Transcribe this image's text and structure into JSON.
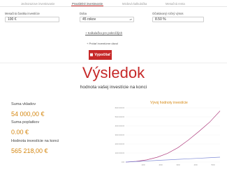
{
  "tabs": [
    {
      "label": "Jednorazove investovanie"
    },
    {
      "label": "Pravidelné investovanie"
    },
    {
      "label": "Mzdová kalkulačka"
    },
    {
      "label": "Mesačná renta"
    }
  ],
  "form": {
    "monthly_label": "Mesačná čiastka investície",
    "monthly_value": "100 €",
    "duration_label": "Doba",
    "duration_value": "45 rokov",
    "return_label": "Očakávaný ročný výnos",
    "return_value": "8.50 %"
  },
  "more_calc_link": "+ Kalkulačka pre pokročilých",
  "checkbox_label": "+ Prídať inventúrne dávol",
  "calc_button": "Vypočítať",
  "result": {
    "title": "Výsledok",
    "subtitle": "hodnota vašej investície na konci",
    "deposits_label": "Suma vkladov",
    "deposits_value": "54 000,00 €",
    "fees_label": "Suma poplatkov",
    "fees_value": "0.00 €",
    "end_label": "Hodnota investície na konci",
    "end_value": "565 218,00 €"
  },
  "colors": {
    "accent": "#c62828",
    "value": "#d4860f",
    "series_value": "#b04080",
    "series_deposits": "#7e8ad6"
  },
  "chart_data": {
    "type": "line",
    "title": "Vývoj hodnoty investície",
    "ylim": [
      0,
      600000
    ],
    "yticks": [
      "600 000 €",
      "500 000 €",
      "400 000 €",
      "300 000 €",
      "200 000 €",
      "100 000 €",
      "0 €"
    ],
    "xticks": [
      "100",
      "200",
      "300",
      "400",
      "500"
    ],
    "x": [
      0,
      60,
      120,
      180,
      240,
      300,
      360,
      420,
      480,
      540
    ],
    "series": [
      {
        "values": [
          0,
          7500,
          24000,
          53000,
          97000,
          160000,
          245000,
          340000,
          440000,
          565218
        ]
      },
      {
        "values": [
          0,
          6000,
          12000,
          18000,
          24000,
          30000,
          36000,
          42000,
          48000,
          54000
        ]
      }
    ]
  }
}
